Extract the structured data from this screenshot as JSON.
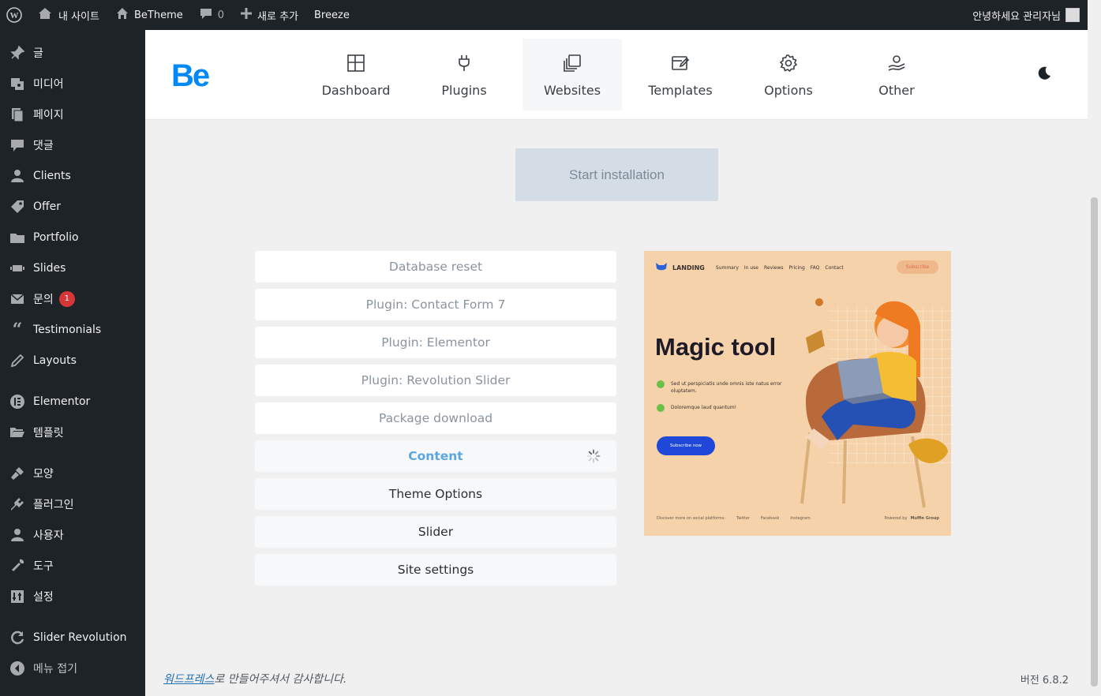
{
  "adminbar": {
    "site_name": "내 사이트",
    "theme_name": "BeTheme",
    "comments_count": "0",
    "new_label": "새로 추가",
    "breeze": "Breeze",
    "greeting": "안녕하세요 관리자님"
  },
  "sidebar": {
    "items": [
      {
        "label": "글",
        "icon": "pin-icon"
      },
      {
        "label": "미디어",
        "icon": "media-icon"
      },
      {
        "label": "페이지",
        "icon": "page-icon"
      },
      {
        "label": "댓글",
        "icon": "comment-icon"
      },
      {
        "label": "Clients",
        "icon": "user-icon"
      },
      {
        "label": "Offer",
        "icon": "tag-icon"
      },
      {
        "label": "Portfolio",
        "icon": "portfolio-icon"
      },
      {
        "label": "Slides",
        "icon": "slides-icon"
      },
      {
        "label": "문의",
        "icon": "mail-icon",
        "badge": "1"
      },
      {
        "label": "Testimonials",
        "icon": "quote-icon"
      },
      {
        "label": "Layouts",
        "icon": "edit-icon"
      },
      {
        "label": "Elementor",
        "icon": "elementor-icon"
      },
      {
        "label": "템플릿",
        "icon": "folder-icon"
      },
      {
        "label": "모양",
        "icon": "brush-icon"
      },
      {
        "label": "플러그인",
        "icon": "plugin-icon"
      },
      {
        "label": "사용자",
        "icon": "user-icon"
      },
      {
        "label": "도구",
        "icon": "wrench-icon"
      },
      {
        "label": "설정",
        "icon": "settings-icon"
      },
      {
        "label": "Slider Revolution",
        "icon": "refresh-icon"
      },
      {
        "label": "메뉴 접기",
        "icon": "collapse-icon"
      }
    ]
  },
  "logo": "Be",
  "tabs": [
    "Dashboard",
    "Plugins",
    "Websites",
    "Templates",
    "Options",
    "Other"
  ],
  "start_button": "Start installation",
  "steps": [
    "Database reset",
    "Plugin: Contact Form 7",
    "Plugin: Elementor",
    "Plugin: Revolution Slider",
    "Package download",
    "Content",
    "Theme Options",
    "Slider",
    "Site settings"
  ],
  "preview": {
    "brand": "LANDING",
    "nav": [
      "Summary",
      "In use",
      "Reviews",
      "Pricing",
      "FAQ",
      "Contact"
    ],
    "subscribe": "Subscribe",
    "headline": "Magic tool",
    "bullet1": "Sed ut perspiciatis unde omnis iste natus error oluptatem.",
    "bullet2": "Doloremque laud quantum!",
    "cta": "Subscribe now",
    "footer_left": "Discover more on social platforms:",
    "footer_links": [
      "Twitter",
      "Facebook",
      "Instagram"
    ],
    "powered": "Powered by",
    "powered_brand": "Muffin Group"
  },
  "footer": {
    "link": "워드프레스",
    "text": "로 만들어주셔서 감사합니다.",
    "version": "버전 6.8.2"
  },
  "colors": {
    "brand": "#0089f7",
    "admin_bg": "#1d2327",
    "current_step": "#5aa6e0",
    "badge": "#d63638"
  }
}
